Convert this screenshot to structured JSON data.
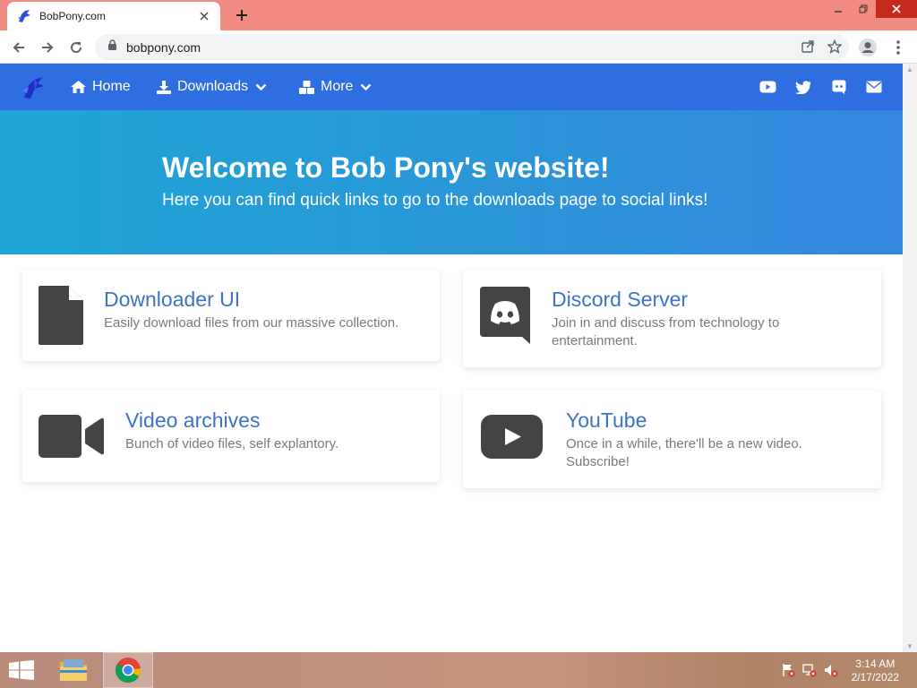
{
  "browser": {
    "tab_title": "BobPony.com",
    "url": "bobpony.com"
  },
  "site": {
    "nav": {
      "home": "Home",
      "downloads": "Downloads",
      "more": "More",
      "social_icons": [
        "youtube-icon",
        "twitter-icon",
        "discord-icon",
        "mail-icon"
      ]
    },
    "hero": {
      "title": "Welcome to Bob Pony's website!",
      "subtitle": "Here you can find quick links to go to the downloads page to social links!"
    },
    "cards": [
      {
        "icon": "file-icon",
        "title": "Downloader UI",
        "desc": "Easily download files from our massive collection."
      },
      {
        "icon": "discord-icon",
        "title": "Discord Server",
        "desc": "Join in and discuss from technology to entertainment."
      },
      {
        "icon": "video-camera-icon",
        "title": "Video archives",
        "desc": "Bunch of video files, self explantory."
      },
      {
        "icon": "youtube-icon",
        "title": "YouTube",
        "desc": "Once in a while, there'll be a new video. Subscribe!"
      }
    ],
    "colors": {
      "navbar": "#2f6ee0",
      "hero_start": "#1fa5d6",
      "hero_end": "#3587e0",
      "card_title": "#3d73c6"
    }
  },
  "taskbar": {
    "time": "3:14 AM",
    "date": "2/17/2022",
    "apps": [
      "file-explorer-icon",
      "chrome-icon"
    ]
  }
}
